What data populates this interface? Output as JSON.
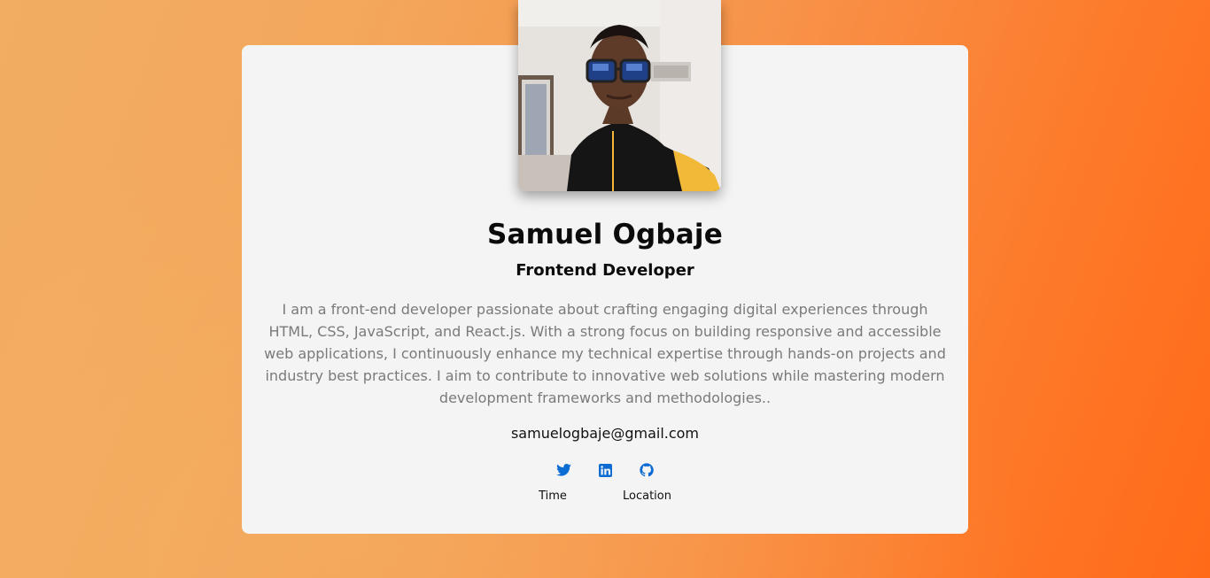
{
  "profile": {
    "name": "Samuel Ogbaje",
    "role": "Frontend Developer",
    "bio": "I am a front-end developer passionate about crafting engaging digital experiences through HTML, CSS, JavaScript, and React.js. With a strong focus on building responsive and accessible web applications, I continuously enhance my technical expertise through hands-on projects and industry best practices. I aim to contribute to innovative web solutions while mastering modern development frameworks and methodologies..",
    "email": "samuelogbaje@gmail.com"
  },
  "social_links": [
    {
      "icon": "twitter-icon"
    },
    {
      "icon": "linkedin-icon"
    },
    {
      "icon": "github-icon"
    }
  ],
  "captions": {
    "time_label": "Time",
    "location_label": "Location"
  },
  "colors": {
    "icon_accent": "#0d6bd4",
    "card_background": "#f4f4f4",
    "gradient_start": "#f2ad62",
    "gradient_end": "#ff6a18"
  }
}
